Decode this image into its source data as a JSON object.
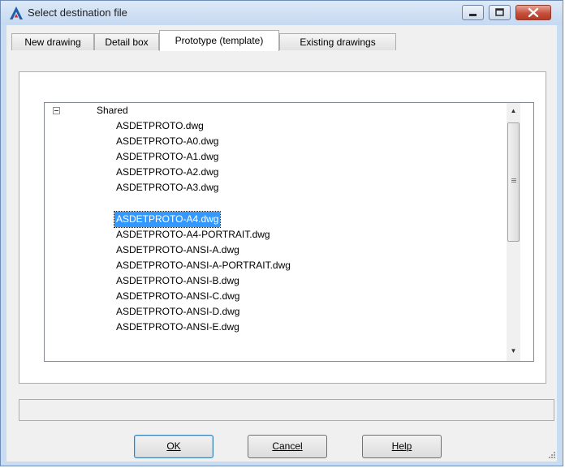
{
  "window": {
    "title": "Select destination file"
  },
  "tabs": [
    {
      "label": "New drawing"
    },
    {
      "label": "Detail box"
    },
    {
      "label": "Prototype (template)"
    },
    {
      "label": "Existing drawings"
    }
  ],
  "tree": {
    "root_label": "Shared",
    "items": [
      {
        "label": "ASDETPROTO.dwg"
      },
      {
        "label": "ASDETPROTO-A0.dwg"
      },
      {
        "label": "ASDETPROTO-A1.dwg"
      },
      {
        "label": "ASDETPROTO-A2.dwg"
      },
      {
        "label": "ASDETPROTO-A3.dwg"
      },
      {
        "label": "ASDETPROTO-A4.dwg"
      },
      {
        "label": "ASDETPROTO-A4-PORTRAIT.dwg"
      },
      {
        "label": "ASDETPROTO-ANSI-A.dwg"
      },
      {
        "label": "ASDETPROTO-ANSI-A-PORTRAIT.dwg"
      },
      {
        "label": "ASDETPROTO-ANSI-B.dwg"
      },
      {
        "label": "ASDETPROTO-ANSI-C.dwg"
      },
      {
        "label": "ASDETPROTO-ANSI-D.dwg"
      },
      {
        "label": "ASDETPROTO-ANSI-E.dwg"
      }
    ],
    "selected_index": 5
  },
  "buttons": {
    "ok_label": "OK",
    "cancel_label": "Cancel",
    "help_label": "Help"
  },
  "colors": {
    "selection": "#3399ff",
    "app_icon": "#1f5ea8"
  }
}
